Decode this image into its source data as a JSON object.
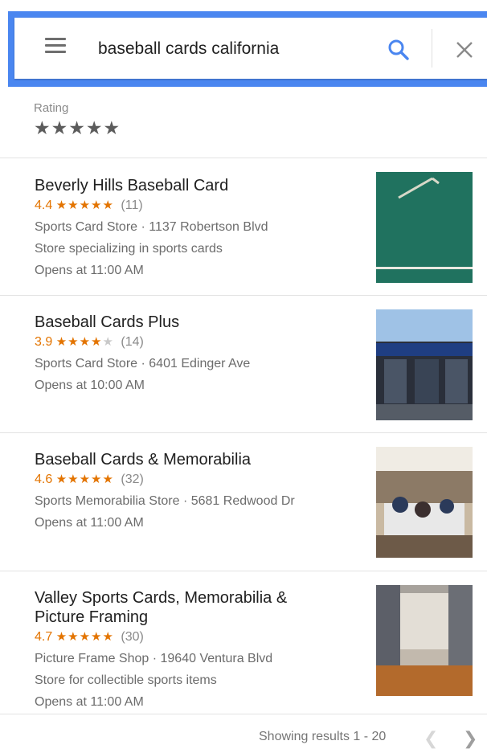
{
  "search": {
    "query": "baseball cards california",
    "menu_icon": "hamburger-menu-icon",
    "search_icon": "search-icon",
    "close_icon": "close-icon",
    "accent_color": "#4a86f0"
  },
  "filter": {
    "label": "Rating",
    "stars": "★★★★★"
  },
  "results": [
    {
      "name": "Beverly Hills Baseball Card",
      "rating": "4.4",
      "stars_full": "★★★★",
      "stars_half": "★",
      "stars_empty": "",
      "count": "(11)",
      "category_address": "Sports Card Store · 1137 Robertson Blvd",
      "description": "Store specializing in sports cards",
      "hours": "Opens at 11:00 AM"
    },
    {
      "name": "Baseball Cards Plus",
      "rating": "3.9",
      "stars_full": "★★★★",
      "stars_half": "",
      "stars_empty": "★",
      "count": "(14)",
      "category_address": "Sports Card Store · 6401 Edinger Ave",
      "hours": "Opens at 10:00 AM"
    },
    {
      "name": "Baseball Cards & Memorabilia",
      "rating": "4.6",
      "stars_full": "★★★★",
      "stars_half": "★",
      "stars_empty": "",
      "count": "(32)",
      "category_address": "Sports Memorabilia Store · 5681 Redwood Dr",
      "hours": "Opens at 11:00 AM"
    },
    {
      "name_line1": "Valley Sports Cards, Memorabilia &",
      "name_line2": "Picture Framing",
      "rating": "4.7",
      "stars_full": "★★★★",
      "stars_half": "★",
      "stars_empty": "",
      "count": "(30)",
      "category_address": "Picture Frame Shop · 19640 Ventura Blvd",
      "description": "Store for collectible sports items",
      "hours": "Opens at 11:00 AM"
    }
  ],
  "rating_color": "#e37400",
  "footer": {
    "text": "Showing results 1 - 20",
    "prev_icon": "chevron-left-icon",
    "next_icon": "chevron-right-icon"
  }
}
